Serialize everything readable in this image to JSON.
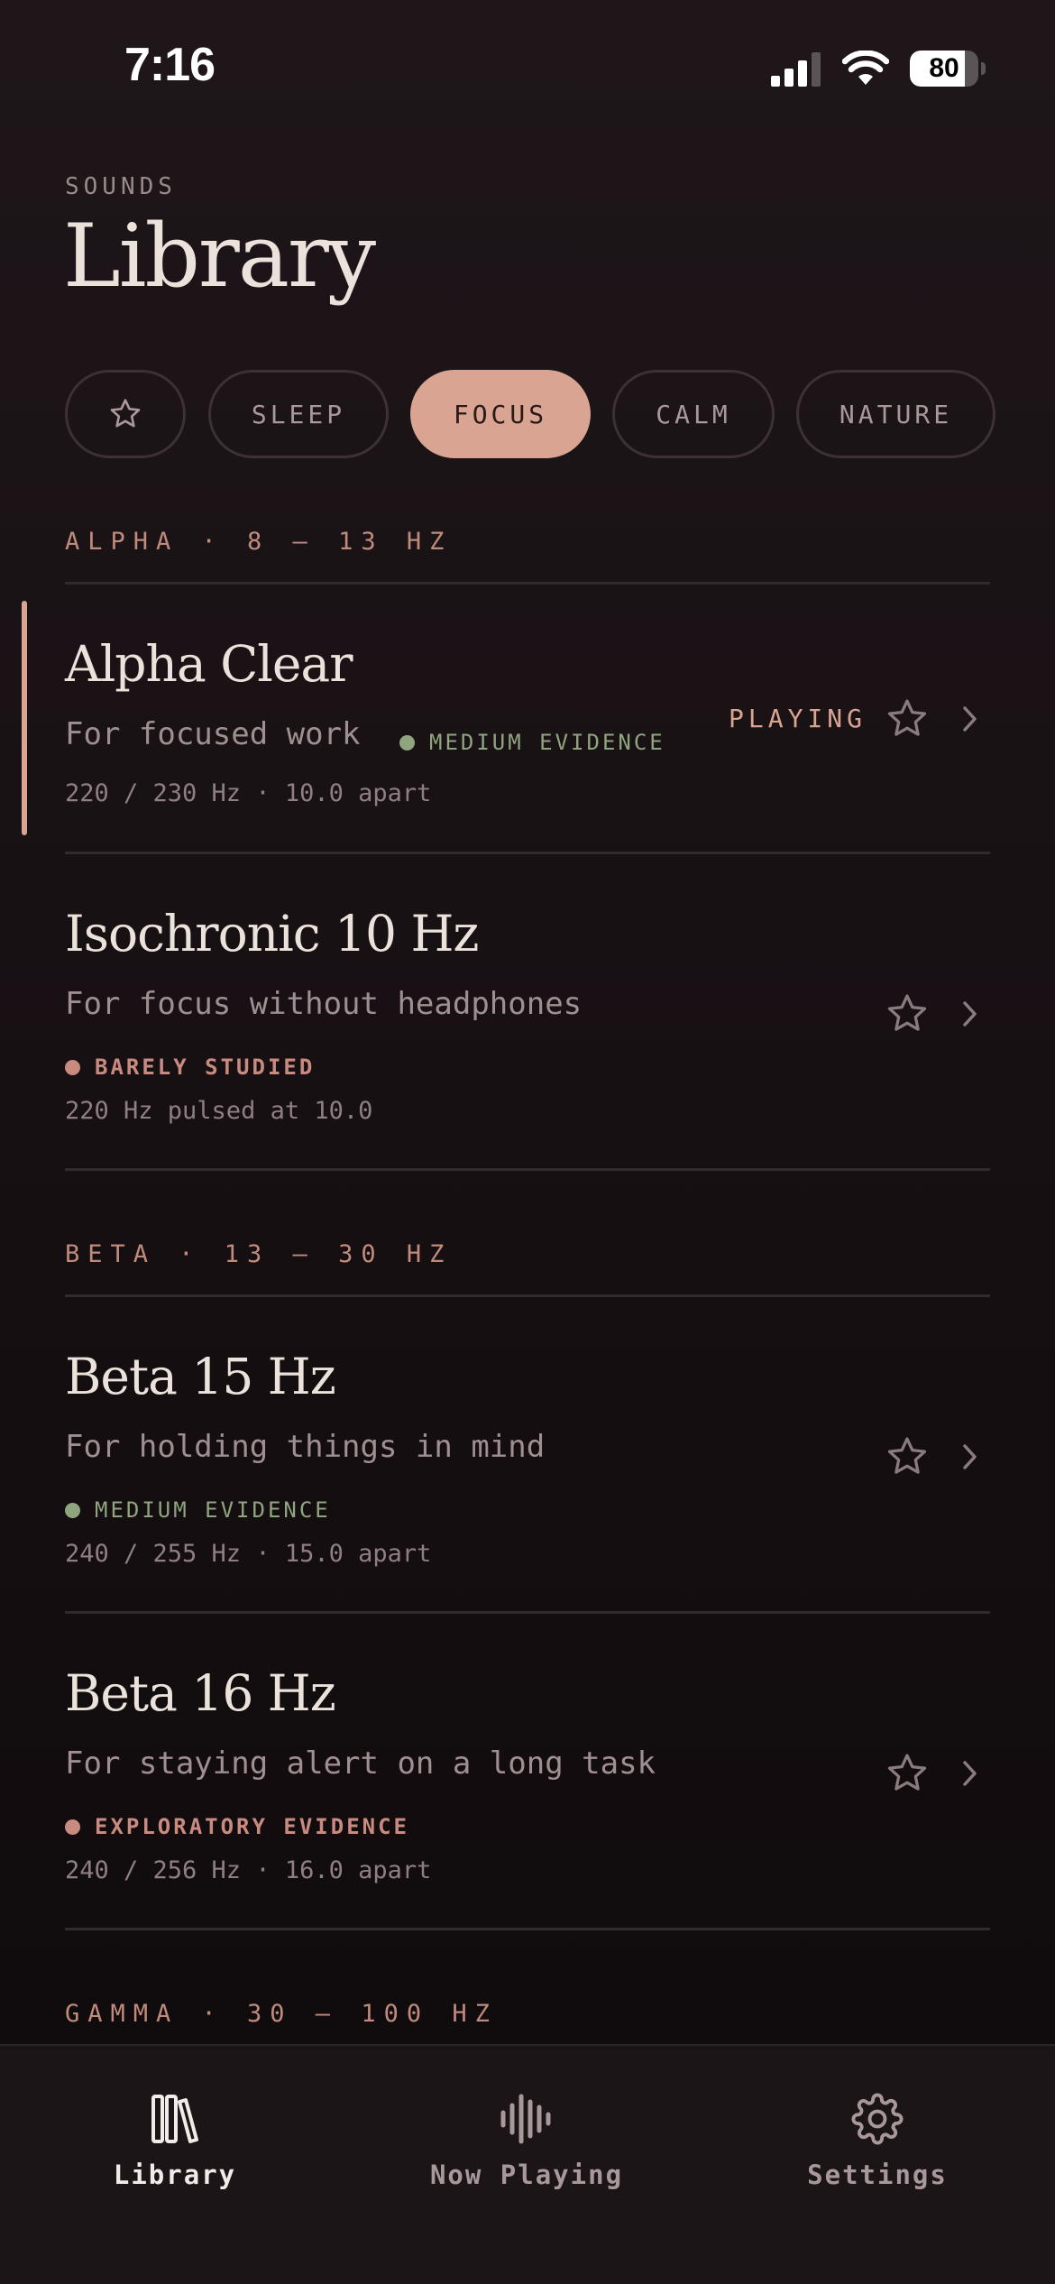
{
  "status_bar": {
    "time": "7:16",
    "battery": "80",
    "battery_level": 0.8
  },
  "header": {
    "eyebrow": "SOUNDS",
    "title": "Library"
  },
  "filters": {
    "favorites_icon": "star-icon",
    "chips": [
      {
        "label": "SLEEP",
        "active": false
      },
      {
        "label": "FOCUS",
        "active": true
      },
      {
        "label": "CALM",
        "active": false
      },
      {
        "label": "NATURE",
        "active": false
      }
    ]
  },
  "sections": {
    "alpha": {
      "header": "ALPHA · 8 – 13 HZ",
      "tracks": [
        {
          "title": "Alpha Clear",
          "description": "For focused work",
          "evidence": "MEDIUM EVIDENCE",
          "frequency": "220 / 230 Hz · 10.0 apart",
          "status": "PLAYING"
        },
        {
          "title": "Isochronic 10 Hz",
          "description": "For focus without headphones",
          "evidence": "BARELY STUDIED",
          "frequency": "220 Hz pulsed at 10.0"
        }
      ]
    },
    "beta": {
      "header": "BETA · 13 – 30 HZ",
      "tracks": [
        {
          "title": "Beta 15 Hz",
          "description": "For holding things in mind",
          "evidence": "MEDIUM EVIDENCE",
          "frequency": "240 / 255 Hz · 15.0 apart"
        },
        {
          "title": "Beta 16 Hz",
          "description": "For staying alert on a long task",
          "evidence": "EXPLORATORY EVIDENCE",
          "frequency": "240 / 256 Hz · 16.0 apart"
        }
      ]
    },
    "gamma": {
      "header": "GAMMA · 30 – 100 HZ"
    }
  },
  "tab_bar": {
    "items": [
      {
        "label": "Library",
        "icon": "library-icon",
        "active": true
      },
      {
        "label": "Now Playing",
        "icon": "waveform-icon",
        "active": false
      },
      {
        "label": "Settings",
        "icon": "gear-icon",
        "active": false
      }
    ]
  },
  "colors": {
    "accent": "#d9a592",
    "evidence_medium": "#8fa57f",
    "evidence_low": "#c98a80",
    "background": "#1e1619"
  }
}
